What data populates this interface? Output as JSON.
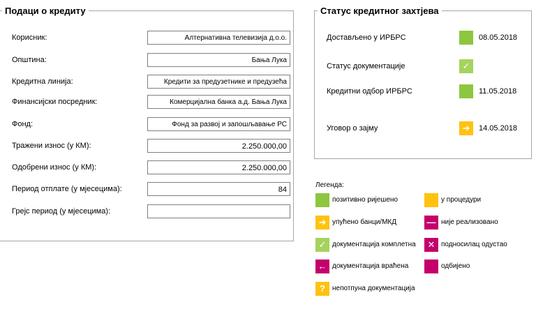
{
  "loan_panel": {
    "title": "Подаци о кредиту",
    "fields": [
      {
        "label": "Корисник:",
        "value": "Алтернативна телевизија д.о.о."
      },
      {
        "label": "Општина:",
        "value": "Бања Лука"
      },
      {
        "label": "Кредитна линија:",
        "value": "Кредити за предузетнике и предузећа"
      },
      {
        "label": "Финансијски посредник:",
        "value": "Комерцијална банка а.д. Бања Лука"
      },
      {
        "label": "Фонд:",
        "value": "Фонд за развој и запошљавање РС"
      },
      {
        "label": "Тражени износ (у КМ):",
        "value": "2.250.000,00"
      },
      {
        "label": "Одобрени износ (у КМ):",
        "value": "2.250.000,00"
      },
      {
        "label": "Период отплате (у мјесецима):",
        "value": "84"
      },
      {
        "label": "Грејс период (у мјесецима):",
        "value": ""
      }
    ]
  },
  "status_panel": {
    "title": "Статус кредитног захтјева",
    "rows": [
      {
        "label": "Достављено у ИРБРС",
        "date": "08.05.2018",
        "icon": "green-square-icon",
        "color": "#8dc63f"
      },
      {
        "label": "Статус документације",
        "date": "",
        "icon": "checkmark-icon",
        "color": "#8dc63f"
      },
      {
        "label": "Кредитни одбор ИРБРС",
        "date": "11.05.2018",
        "icon": "green-square-icon",
        "color": "#8dc63f"
      },
      {
        "label": "Уговор о зајму",
        "date": "14.05.2018",
        "icon": "arrow-right-icon",
        "color": "#ffc20e"
      }
    ]
  },
  "legend": {
    "title": "Легенда:",
    "items": [
      {
        "label": "позитивно ријешено",
        "icon": "green-square-icon",
        "color": "#8dc63f"
      },
      {
        "label": "у процедури",
        "icon": "yellow-square-icon",
        "color": "#ffc20e"
      },
      {
        "label": "упућено банци/МКД",
        "icon": "arrow-right-icon",
        "color": "#ffc20e"
      },
      {
        "label": "није реализовано",
        "icon": "minus-icon",
        "color": "#c4006b"
      },
      {
        "label": "документација комплетна",
        "icon": "checkmark-icon",
        "color": "#8dc63f"
      },
      {
        "label": "подносилац одустао",
        "icon": "x-icon",
        "color": "#c4006b"
      },
      {
        "label": "документација враћена",
        "icon": "arrow-left-icon",
        "color": "#c4006b"
      },
      {
        "label": "одбијено",
        "icon": "magenta-square-icon",
        "color": "#c4006b"
      },
      {
        "label": "непотпуна документација",
        "icon": "question-icon",
        "color": "#ffc20e"
      }
    ]
  }
}
